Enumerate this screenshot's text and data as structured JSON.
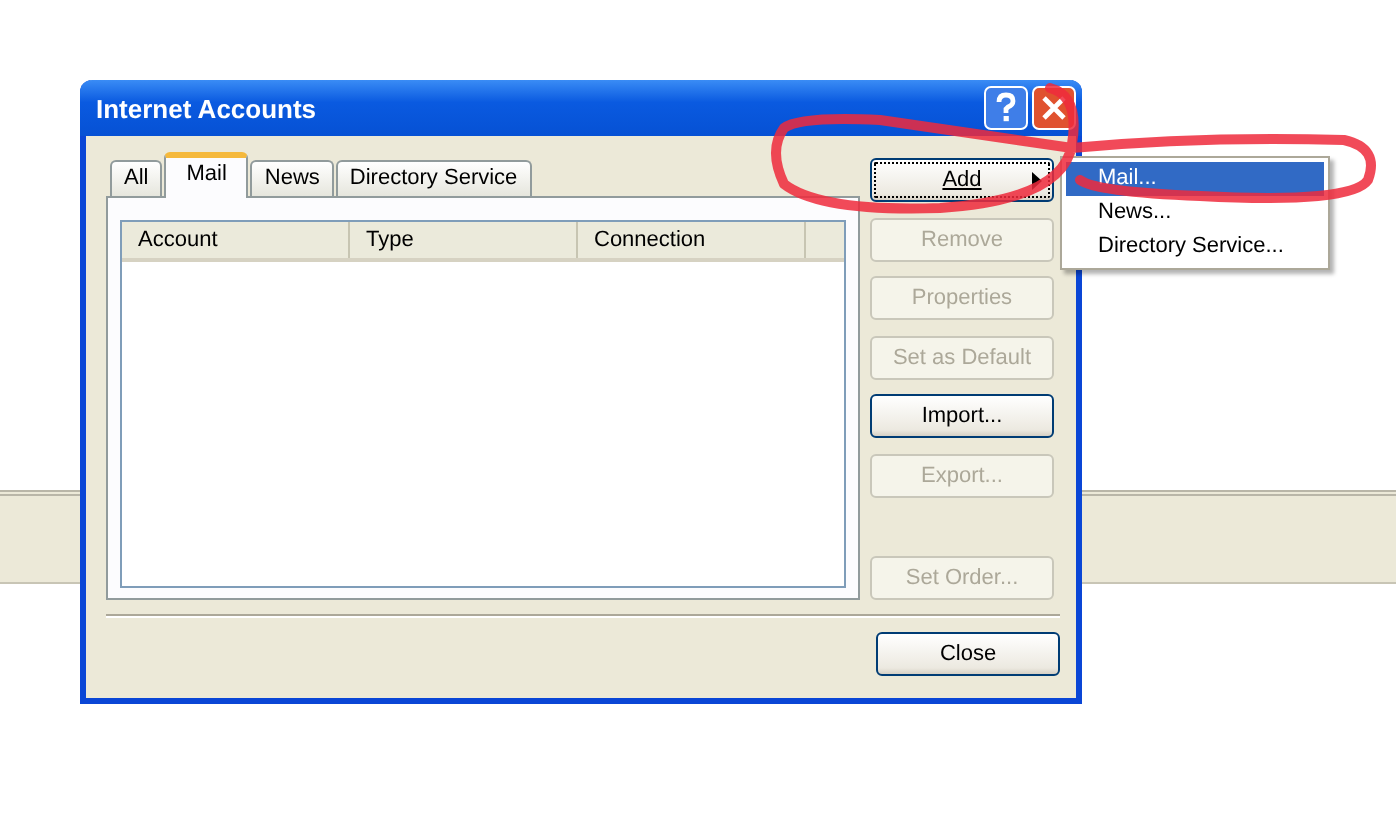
{
  "window": {
    "title": "Internet Accounts"
  },
  "tabs": [
    {
      "label": "All",
      "selected": false
    },
    {
      "label": "Mail",
      "selected": true
    },
    {
      "label": "News",
      "selected": false
    },
    {
      "label": "Directory Service",
      "selected": false
    }
  ],
  "table": {
    "columns": [
      "Account",
      "Type",
      "Connection"
    ]
  },
  "buttons": [
    {
      "label": "Add",
      "disabled": false,
      "focused": true,
      "kind": "submenu"
    },
    {
      "label": "Remove",
      "disabled": true,
      "focused": false,
      "kind": "plain"
    },
    {
      "label": "Properties",
      "disabled": true,
      "focused": false,
      "kind": "plain"
    },
    {
      "label": "Set as Default",
      "disabled": true,
      "focused": false,
      "kind": "plain"
    },
    {
      "label": "Import...",
      "disabled": false,
      "focused": false,
      "kind": "plain"
    },
    {
      "label": "Export...",
      "disabled": true,
      "focused": false,
      "kind": "plain"
    }
  ],
  "set_order_button": {
    "label": "Set Order...",
    "disabled": true
  },
  "close_button": {
    "label": "Close"
  },
  "add_menu": [
    {
      "label": "Mail...",
      "selected": true
    },
    {
      "label": "News...",
      "selected": false
    },
    {
      "label": "Directory Service...",
      "selected": false
    }
  ]
}
